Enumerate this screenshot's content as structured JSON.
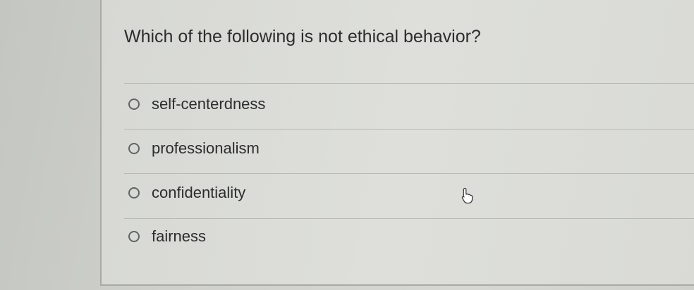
{
  "question": {
    "text": "Which of the following is not ethical behavior?"
  },
  "options": [
    {
      "label": "self-centerdness",
      "selected": false
    },
    {
      "label": "professionalism",
      "selected": false
    },
    {
      "label": "confidentiality",
      "selected": false
    },
    {
      "label": "fairness",
      "selected": false
    }
  ],
  "icons": {
    "radio": "radio-button-empty",
    "cursor": "hand-pointer-cursor"
  }
}
